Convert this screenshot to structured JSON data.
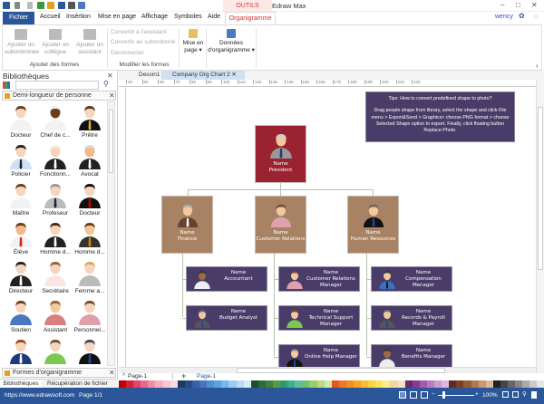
{
  "app": {
    "title": "Edraw Max",
    "context_tab": "OUTILS DOCUME...",
    "user": "wency"
  },
  "menu": {
    "file": "Fichier",
    "tabs": [
      "Accueil",
      "Insértion",
      "Mise en page",
      "Affichage",
      "Symboles",
      "Aide"
    ],
    "active": "Organigramme"
  },
  "ribbon": {
    "add": {
      "items": [
        "Ajouter un subordonnée",
        "Ajouter un collègue",
        "Ajouter un assistant"
      ],
      "group": "Ajouter des formes"
    },
    "modify": {
      "items": [
        "Convertir à l'assistant",
        "Convertir au subordonné",
        "Déconnecter"
      ],
      "group": "Modifier les formes"
    },
    "layout": {
      "line1": "Mise en",
      "line2": "page"
    },
    "data": {
      "line1": "Données",
      "line2": "d'organigramme"
    }
  },
  "library": {
    "title": "Bibliothèques",
    "section": "Demi-longueur de personne",
    "section2": "Formes d'organigramme",
    "items": [
      "Docteur",
      "Chef de c...",
      "Prêtre",
      "Policier",
      "Fonctionn...",
      "Avocat",
      "Maître",
      "Profeseur",
      "Docteur",
      "Élève",
      "Homme d...",
      "Homme d...",
      "Directeur",
      "Secrétaire",
      "Femme a...",
      "Soutien",
      "Assistant",
      "Personnel...",
      "",
      "",
      ""
    ],
    "bottom_tabs": [
      "Bibliothèques",
      "Récupération de fichier"
    ]
  },
  "doc_tabs": [
    "Dessin1",
    "Company Org Chart 2"
  ],
  "ruler": [
    "40",
    "50",
    "60",
    "70",
    "80",
    "90",
    "100",
    "110",
    "120",
    "130",
    "140",
    "150",
    "160",
    "170",
    "180",
    "190",
    "200",
    "210",
    "220"
  ],
  "tip": {
    "title": "Tips: How to convert predefined shape to photo?",
    "body": "Drag people shape from library, select the shape and click File menu > Export&Send > Graphics> choose PNG format > choose Selected Shape option to export. Finally, click floating button Replace Photo."
  },
  "org": {
    "president": {
      "name": "Name",
      "title": "President",
      "color": "#9b2230"
    },
    "heads": [
      {
        "name": "Name",
        "title": "Finance"
      },
      {
        "name": "Name",
        "title": "Customer Relations"
      },
      {
        "name": "Name",
        "title": "Human Resources"
      }
    ],
    "head_color": "#a88363",
    "staff": [
      [
        {
          "name": "Name",
          "title": "Accountant"
        },
        {
          "name": "Name",
          "title": "Budget Analyst"
        }
      ],
      [
        {
          "name": "Name",
          "title": "Customer Relations Manager"
        },
        {
          "name": "Name",
          "title": "Technical Support Manager"
        },
        {
          "name": "Name",
          "title": "Online Help Manager"
        }
      ],
      [
        {
          "name": "Name",
          "title": "Compensation Manager"
        },
        {
          "name": "Name",
          "title": "Records & Payroll Manager"
        },
        {
          "name": "Name",
          "title": "Benefits Manager"
        }
      ]
    ]
  },
  "pages": {
    "selector": "Page-1",
    "active": "Page-1"
  },
  "status": {
    "url": "https://www.edrawsoft.com",
    "page": "Page 1/1",
    "zoom": "100%"
  },
  "palette": [
    "#c00000",
    "#d6203a",
    "#e0436b",
    "#e86a8a",
    "#ef8fa5",
    "#f4aebd",
    "#f7c6d0",
    "#fad9e0",
    "#1f3864",
    "#2e4a86",
    "#3a5fa8",
    "#4472c4",
    "#4f8fd6",
    "#5ba3e0",
    "#76b8e8",
    "#9ccbee",
    "#bcdcf3",
    "#d7eaf8",
    "#1e4d2b",
    "#2e6b3c",
    "#3f7f3f",
    "#5a9a3a",
    "#2e9a6b",
    "#3fb08a",
    "#5ac0a0",
    "#70c070",
    "#99cc66",
    "#b8d88a",
    "#d4e6a8",
    "#e05a1e",
    "#ea7a22",
    "#f08f2a",
    "#f5a623",
    "#f9be2f",
    "#fbd23f",
    "#fce35a",
    "#fdeb8a",
    "#f2d6a0",
    "#f6e2c0",
    "#6a2c70",
    "#8b3a8f",
    "#a45ca8",
    "#b87cc0",
    "#cc9ad2",
    "#dcb8e0",
    "#5a2e1e",
    "#7a4028",
    "#955a3a",
    "#b07850",
    "#c89870",
    "#dbb898",
    "#222222",
    "#444444",
    "#666666",
    "#888888",
    "#aaaaaa",
    "#cccccc",
    "#e6e6e6"
  ]
}
